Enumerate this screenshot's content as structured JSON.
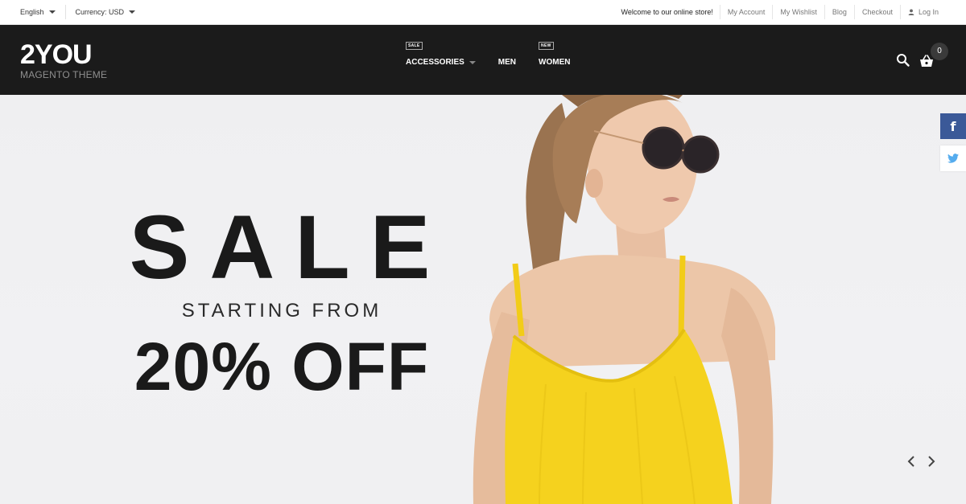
{
  "topbar": {
    "language": "English",
    "currency": "Currency: USD",
    "welcome": "Welcome to our online store!",
    "links": [
      "My Account",
      "My Wishlist",
      "Blog",
      "Checkout"
    ],
    "login": "Log In"
  },
  "header": {
    "logo_name": "2YOU",
    "logo_sub": "MAGENTO THEME",
    "nav": [
      {
        "label": "ACCESSORIES",
        "badge": "SALE"
      },
      {
        "label": "MEN",
        "badge": ""
      },
      {
        "label": "WOMEN",
        "badge": "NEW"
      }
    ],
    "cart_count": "0"
  },
  "hero": {
    "title": "SALE",
    "subtitle": "STARTING FROM",
    "offer": "20% OFF"
  },
  "icons": [
    "chevron-down-icon",
    "user-icon",
    "search-icon",
    "basket-icon",
    "facebook-icon",
    "twitter-icon",
    "chevron-left-icon",
    "chevron-right-icon"
  ],
  "colors": {
    "header_bg": "#1b1b1b",
    "dress": "#f5d21e",
    "facebook": "#3b5998",
    "twitter": "#55acee"
  }
}
